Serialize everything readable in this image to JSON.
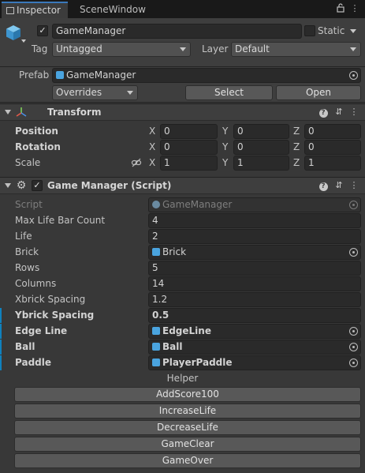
{
  "tabs": [
    {
      "label": "Inspector"
    },
    {
      "label": "SceneWindow"
    }
  ],
  "header": {
    "object_name": "GameManager",
    "active": true,
    "static_label": "Static",
    "tag_label": "Tag",
    "tag_value": "Untagged",
    "layer_label": "Layer",
    "layer_value": "Default",
    "prefab_label": "Prefab",
    "prefab_value": "GameManager",
    "overrides_label": "Overrides",
    "select_label": "Select",
    "open_label": "Open"
  },
  "transform": {
    "title": "Transform",
    "rows": [
      {
        "label": "Position",
        "x": "0",
        "y": "0",
        "z": "0"
      },
      {
        "label": "Rotation",
        "x": "0",
        "y": "0",
        "z": "0"
      },
      {
        "label": "Scale",
        "x": "1",
        "y": "1",
        "z": "1"
      }
    ],
    "axes": {
      "x": "X",
      "y": "Y",
      "z": "Z"
    }
  },
  "script_component": {
    "title": "Game Manager (Script)",
    "enabled": true,
    "fields": [
      {
        "label": "Script",
        "value": "GameManager"
      },
      {
        "label": "Max Life Bar Count",
        "value": "4"
      },
      {
        "label": "Life",
        "value": "2"
      },
      {
        "label": "Brick",
        "value": "Brick"
      },
      {
        "label": "Rows",
        "value": "5"
      },
      {
        "label": "Columns",
        "value": "14"
      },
      {
        "label": "Xbrick Spacing",
        "value": "1.2"
      },
      {
        "label": "Ybrick Spacing",
        "value": "0.5"
      },
      {
        "label": "Edge Line",
        "value": "EdgeLine"
      },
      {
        "label": "Ball",
        "value": "Ball"
      },
      {
        "label": "Paddle",
        "value": "PlayerPaddle"
      }
    ],
    "helper_label": "Helper",
    "buttons": [
      "AddScore100",
      "IncreaseLife",
      "DecreaseLife",
      "GameClear",
      "GameOver"
    ]
  },
  "colors": {
    "background": "#383838",
    "accent": "#3a79bb",
    "modified_bar": "#0f81be",
    "object_icon": "#4aa4df"
  },
  "icons": [
    "cube-icon",
    "lock-icon",
    "menu-icon",
    "transform-icon",
    "gear-icon",
    "help-icon",
    "preset-icon",
    "kebab-icon",
    "link-icon",
    "object-picker-icon"
  ]
}
